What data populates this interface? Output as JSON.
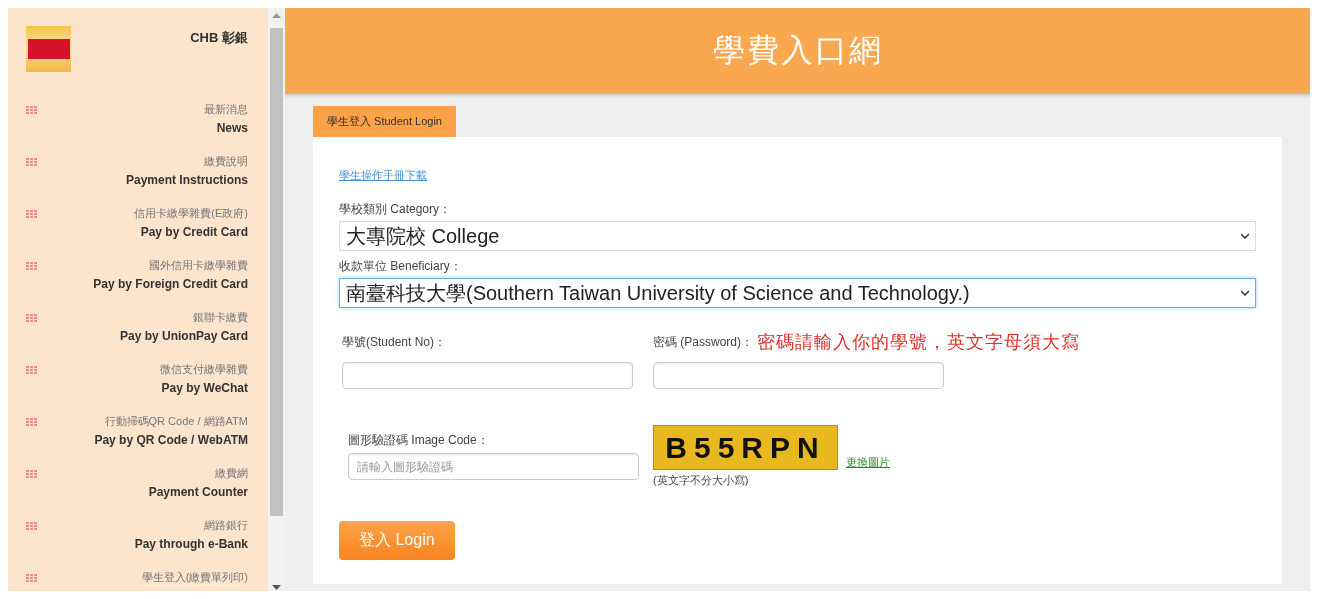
{
  "sidebar": {
    "brand": "CHB 彰銀",
    "items": [
      {
        "zh": "最新消息",
        "en": "News"
      },
      {
        "zh": "繳費說明",
        "en": "Payment Instructions"
      },
      {
        "zh": "信用卡繳學雜費(E政府)",
        "en": "Pay by Credit Card"
      },
      {
        "zh": "國外信用卡繳學雜費",
        "en": "Pay by Foreign Credit Card"
      },
      {
        "zh": "銀聯卡繳費",
        "en": "Pay by UnionPay Card"
      },
      {
        "zh": "微信支付繳學雜費",
        "en": "Pay by WeChat"
      },
      {
        "zh": "行動掃碼QR Code / 網路ATM",
        "en": "Pay by QR Code / WebATM"
      },
      {
        "zh": "繳費網",
        "en": "Payment Counter"
      },
      {
        "zh": "網路銀行",
        "en": "Pay through e-Bank"
      },
      {
        "zh": "學生登入(繳費單列印)"
      }
    ]
  },
  "header": {
    "title": "學費入口網"
  },
  "tabs": [
    {
      "label": "學生登入 Student Login",
      "selected": true
    }
  ],
  "form": {
    "manual_link": "學生操作手冊下載",
    "category": {
      "label": "學校類別 Category：",
      "value": "大專院校 College",
      "focused": false
    },
    "beneficiary": {
      "label": "收款單位 Beneficiary：",
      "value": "南臺科技大學(Southern Taiwan University of Science and Technology.)",
      "focused": true
    },
    "student_no": {
      "label": "學號(Student No)："
    },
    "password": {
      "label": "密碼 (Password)：",
      "note": "密碼請輸入你的學號，英文字母須大寫"
    },
    "image_code": {
      "label": "圖形驗證碼 Image Code：",
      "placeholder": "請輸入圖形驗證碼"
    },
    "captcha": {
      "code": "B55RPN",
      "refresh_link": "更換圖片",
      "hint": "(英文字不分大小寫)"
    },
    "login_button": "登入 Login"
  }
}
